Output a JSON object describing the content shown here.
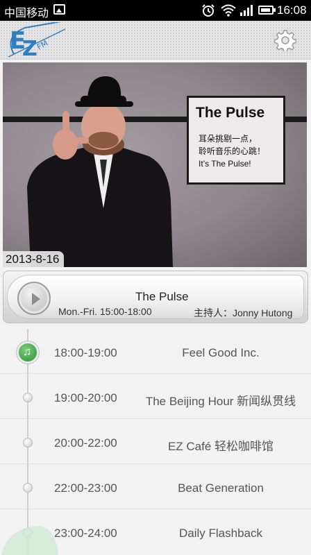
{
  "status_bar": {
    "carrier": "中国移动",
    "time": "16:08"
  },
  "header": {
    "logo_text": "EZ FM"
  },
  "banner": {
    "promo_title": "The Pulse",
    "promo_text": "耳朵挑剔一点，\n聆听音乐的心跳！\nIt’s The Pulse!",
    "date": "2013-8-16"
  },
  "now_playing": {
    "title": "The Pulse",
    "time": "Mon.-Fri. 15:00-18:00",
    "host": "主持人：Jonny Hutong"
  },
  "schedule": [
    {
      "time": "18:00-19:00",
      "name": "Feel Good Inc.",
      "active": true
    },
    {
      "time": "19:00-20:00",
      "name": "The Beijing Hour 新闻纵贯线",
      "active": false
    },
    {
      "time": "20:00-22:00",
      "name": "EZ Café 轻松咖啡馆",
      "active": false
    },
    {
      "time": "22:00-23:00",
      "name": "Beat Generation",
      "active": false
    },
    {
      "time": "23:00-24:00",
      "name": "Daily Flashback",
      "active": false
    }
  ],
  "colors": {
    "accent_green": "#2d8f34",
    "logo_blue": "#2f7fc0"
  }
}
